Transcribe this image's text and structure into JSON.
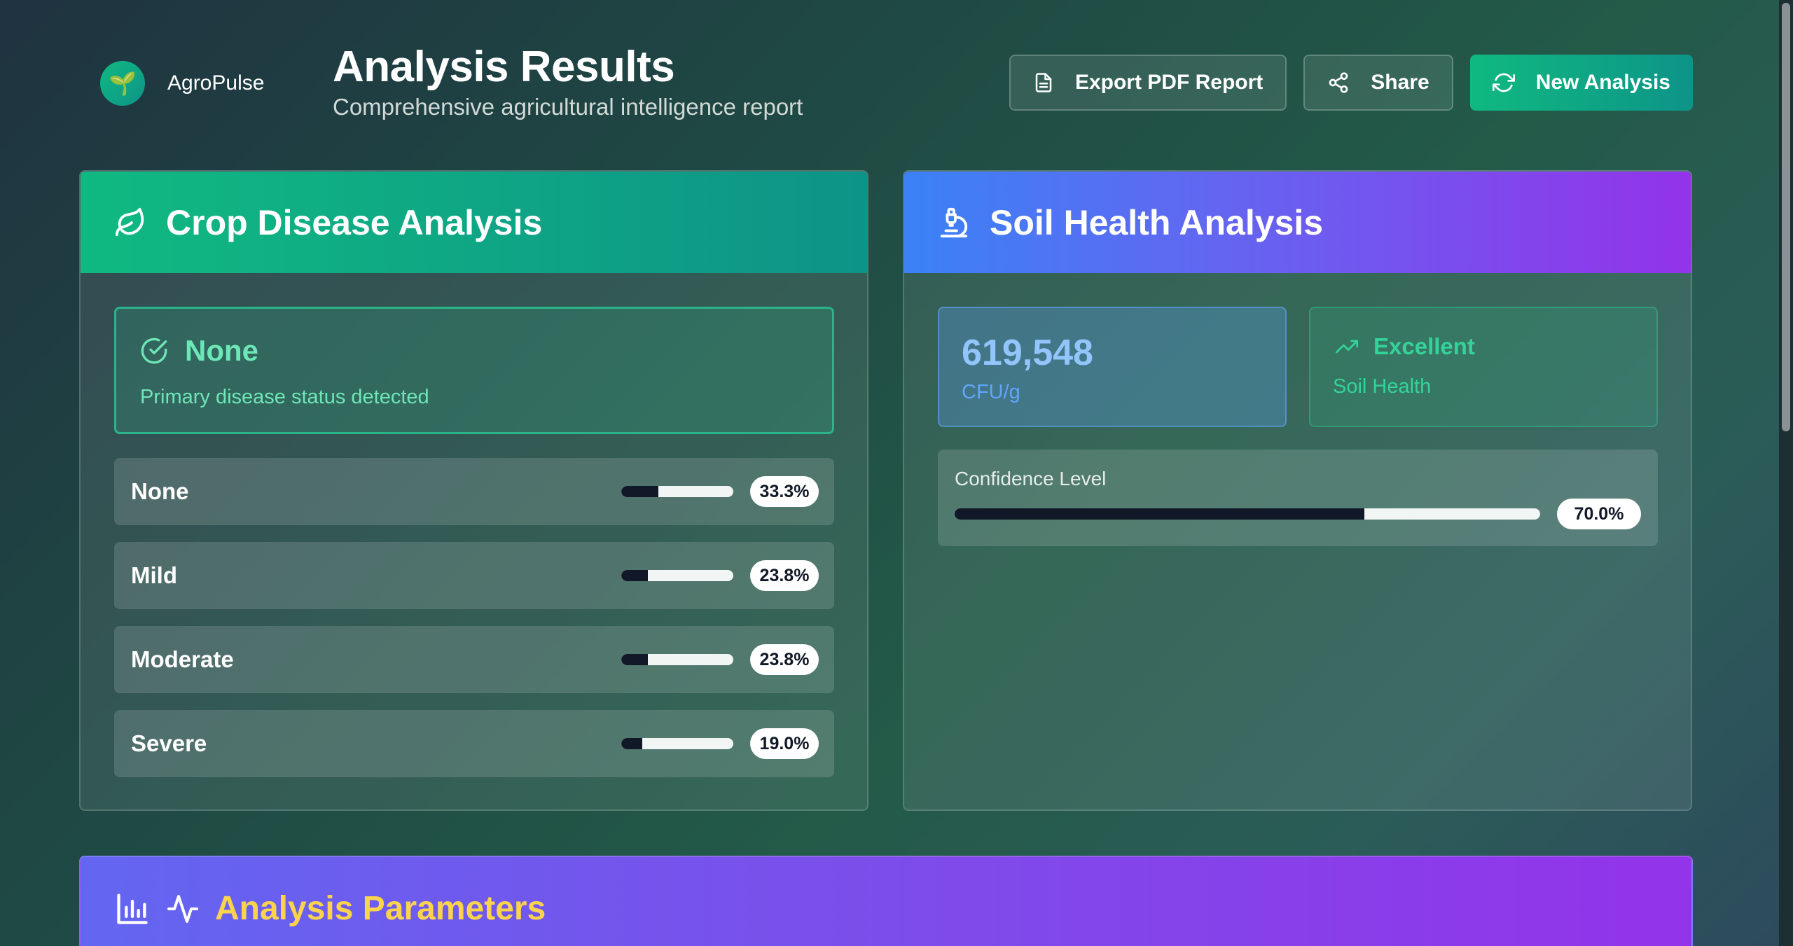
{
  "brand": {
    "name": "AgroPulse",
    "logo_icon": "seedling-icon"
  },
  "header": {
    "title": "Analysis Results",
    "subtitle": "Comprehensive agricultural intelligence report"
  },
  "actions": {
    "export_label": "Export PDF Report",
    "share_label": "Share",
    "new_label": "New Analysis"
  },
  "crop": {
    "title": "Crop Disease Analysis",
    "status": "None",
    "status_desc": "Primary disease status detected",
    "rows": [
      {
        "label": "None",
        "percent": "33.3%",
        "value": 33.3
      },
      {
        "label": "Mild",
        "percent": "23.8%",
        "value": 23.8
      },
      {
        "label": "Moderate",
        "percent": "23.8%",
        "value": 23.8
      },
      {
        "label": "Severe",
        "percent": "19.0%",
        "value": 19.0
      }
    ]
  },
  "soil": {
    "title": "Soil Health Analysis",
    "cfu_value": "619,548",
    "cfu_unit": "CFU/g",
    "rating": "Excellent",
    "rating_caption": "Soil Health",
    "confidence_label": "Confidence Level",
    "confidence_percent": "70.0%",
    "confidence_value": 70.0
  },
  "params": {
    "title": "Analysis Parameters"
  },
  "colors": {
    "accent_green": "#10b981",
    "accent_purple": "#9333ea",
    "accent_blue": "#3b82f6",
    "status_green": "#6ee7b7",
    "params_yellow": "#fcd34d"
  }
}
